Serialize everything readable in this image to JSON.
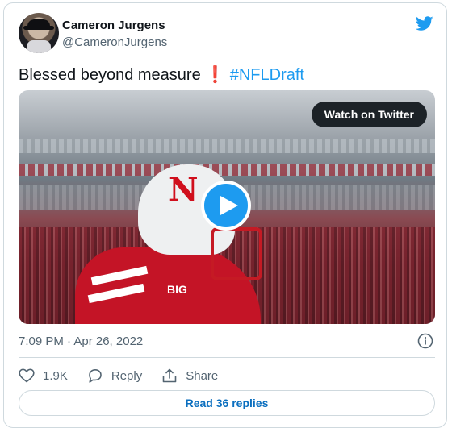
{
  "author": {
    "name": "Cameron Jurgens",
    "handle": "@CameronJurgens"
  },
  "tweet": {
    "text_main": "Blessed beyond measure",
    "text_excl": "❗",
    "hashtag": "#NFLDraft"
  },
  "media": {
    "watch_label": "Watch on Twitter",
    "helmet_letter": "N",
    "jersey_logo": "BIG"
  },
  "meta": {
    "timestamp": "7:09 PM · Apr 26, 2022"
  },
  "actions": {
    "likes": "1.9K",
    "reply_label": "Reply",
    "share_label": "Share"
  },
  "read_replies": "Read 36 replies",
  "colors": {
    "accent": "#1d9bf0",
    "muted": "#536471",
    "border": "#cfd9de"
  },
  "icons": [
    "twitter-bird-icon",
    "play-icon",
    "info-icon",
    "heart-icon",
    "reply-icon",
    "share-icon"
  ]
}
